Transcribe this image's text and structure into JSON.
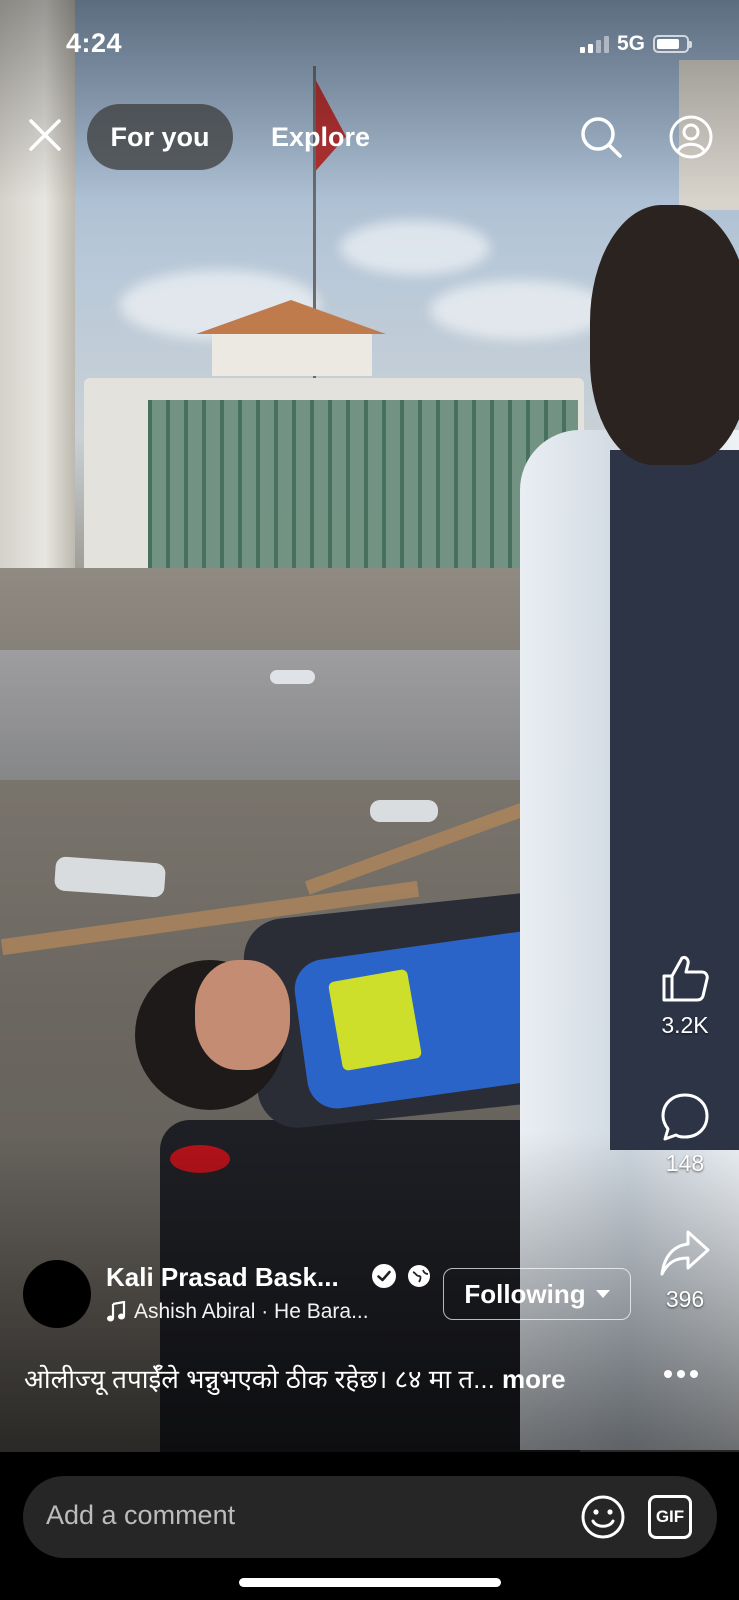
{
  "status_bar": {
    "time": "4:24",
    "network": "5G",
    "battery_level": 0.8
  },
  "top_nav": {
    "close_icon": "close-icon",
    "tabs": [
      {
        "label": "For you",
        "selected": true
      },
      {
        "label": "Explore",
        "selected": false
      }
    ],
    "search_icon": "search-icon",
    "profile_icon": "profile-icon"
  },
  "actions": {
    "like_count": "3.2K",
    "comment_count": "148",
    "share_count": "396"
  },
  "author": {
    "name": "Kali Prasad Bask...",
    "music": "Ashish Abiral · He Bara...",
    "follow_label": "Following"
  },
  "caption": {
    "text": "ओलीज्यू तपाईँले भन्नुभएको ठीक रहेछ। ८४ मा त...",
    "more_label": "more"
  },
  "comment_bar": {
    "placeholder": "Add a comment",
    "gif_label": "GIF"
  },
  "colors": {
    "comment_bar_bg": "#262626",
    "tab_pill_bg": "#3c3c3c"
  }
}
